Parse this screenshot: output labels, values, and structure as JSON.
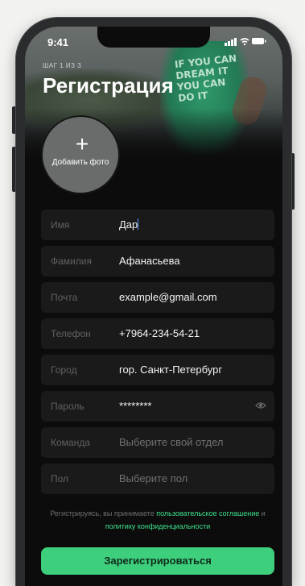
{
  "status_bar": {
    "time": "9:41",
    "icons": "..ıl ᯤ ▬"
  },
  "header": {
    "step": "ШАГ 1 ИЗ 3",
    "title": "Регистрация",
    "hero_shirt_text": "IF YOU CAN DREAM IT YOU CAN DO IT"
  },
  "avatar": {
    "plus": "+",
    "label": "Добавить фото"
  },
  "form": {
    "fields": [
      {
        "label": "Имя",
        "value": "Дар"
      },
      {
        "label": "Фамилия",
        "value": "Афанасьева"
      },
      {
        "label": "Почта",
        "value": "example@gmail.com"
      },
      {
        "label": "Телефон",
        "value": "+7964-234-54-21"
      },
      {
        "label": "Город",
        "value": "гор. Санкт-Петербург"
      },
      {
        "label": "Пароль",
        "value": "********",
        "icon": "eye-icon"
      },
      {
        "label": "Команда",
        "placeholder": "Выберите свой отдел"
      },
      {
        "label": "Пол",
        "placeholder": "Выберите пол"
      }
    ]
  },
  "terms": {
    "prefix": "Регистрируясь, вы принимаете ",
    "link1": "пользовательское соглашение",
    "middle": " и ",
    "link2": "политику конфиденциальности"
  },
  "submit_label": "Зарегистрироваться",
  "colors": {
    "accent": "#3ecf7d",
    "link": "#3ee08a",
    "field_bg": "#1a1a1b",
    "screen_bg": "#0c0c0d"
  }
}
